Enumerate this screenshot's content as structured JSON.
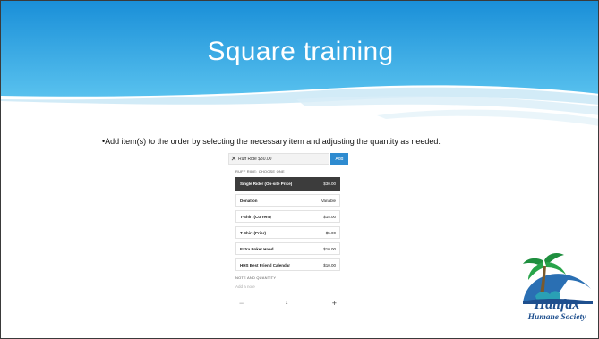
{
  "slide": {
    "title": "Square training",
    "bullet": "•Add item(s) to the order by selecting the necessary item and adjusting the quantity as needed:"
  },
  "square": {
    "item_field": "Ruff Ride $30.00",
    "add_label": "Add",
    "section_label": "RUFF RIDE: CHOOSE ONE",
    "options": [
      {
        "name": "Single Rider (On-site Price)",
        "price": "$30.00",
        "selected": true
      },
      {
        "name": "Donation",
        "price": "Variable",
        "selected": false
      },
      {
        "name": "T-Shirt (Current)",
        "price": "$15.00",
        "selected": false
      },
      {
        "name": "T-Shirt (Prior)",
        "price": "$5.00",
        "selected": false
      },
      {
        "name": "Extra Poker Hand",
        "price": "$10.00",
        "selected": false
      },
      {
        "name": "HHS Best Friend Calendar",
        "price": "$10.00",
        "selected": false
      }
    ],
    "note_label": "NOTE AND QUANTITY",
    "note_placeholder": "Add a note",
    "quantity": "1",
    "minus": "−",
    "plus": "+"
  },
  "logo": {
    "line1": "Halifax",
    "line2": "Humane Society"
  },
  "colors": {
    "banner_top": "#1a8fd8",
    "banner_bottom": "#5cc3ef",
    "add_button": "#2e8bd0",
    "selected_option": "#3c3c3c",
    "logo_text": "#1e4f8e"
  },
  "icons": {
    "close": "close-icon",
    "minus": "minus-icon",
    "plus": "plus-icon",
    "palm": "palm-tree-icon"
  }
}
